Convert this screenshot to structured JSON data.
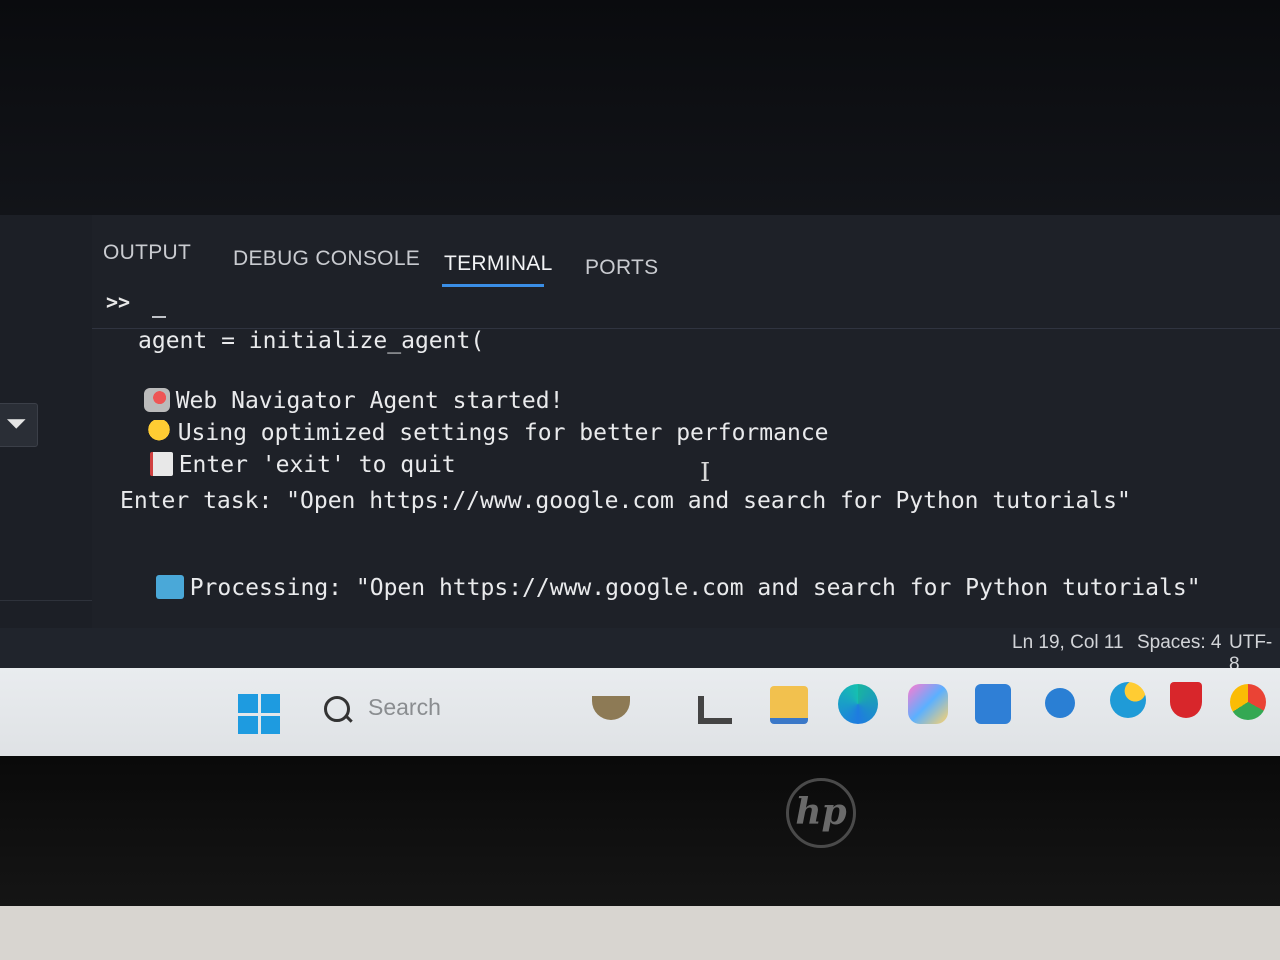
{
  "panel": {
    "tabs": [
      {
        "label": "OUTPUT"
      },
      {
        "label": "DEBUG CONSOLE"
      },
      {
        "label": "TERMINAL"
      },
      {
        "label": "PORTS"
      }
    ],
    "active_tab": "TERMINAL",
    "prompt": ">>"
  },
  "terminal": {
    "lines": [
      "agent = initialize_agent(",
      "Web Navigator Agent started!",
      "Using optimized settings for better performance",
      "Enter 'exit' to quit",
      "Enter task: \"Open https://www.google.com and search for Python tutorials\"",
      "Processing: \"Open https://www.google.com and search for Python tutorials\""
    ],
    "icons": [
      "rocket-icon",
      "lightbulb-icon",
      "memo-icon",
      "processing-icon"
    ]
  },
  "statusbar": {
    "position": "Ln 19, Col 11",
    "spaces": "Spaces: 4",
    "encoding": "UTF-8"
  },
  "taskbar": {
    "search_placeholder": "Search",
    "icons": [
      "windows-start-icon",
      "search-icon",
      "widgets-icon",
      "app-l-icon",
      "file-explorer-icon",
      "edge-icon",
      "copilot-icon",
      "microsoft-store-icon",
      "hp-app-icon",
      "get-help-icon",
      "mcafee-icon",
      "chrome-icon"
    ]
  },
  "bezel": {
    "logo": "hp"
  },
  "colors": {
    "tab_underline": "#3a8ee6",
    "panel_bg": "#1e2128",
    "taskbar_bg": "#e9ecef"
  }
}
